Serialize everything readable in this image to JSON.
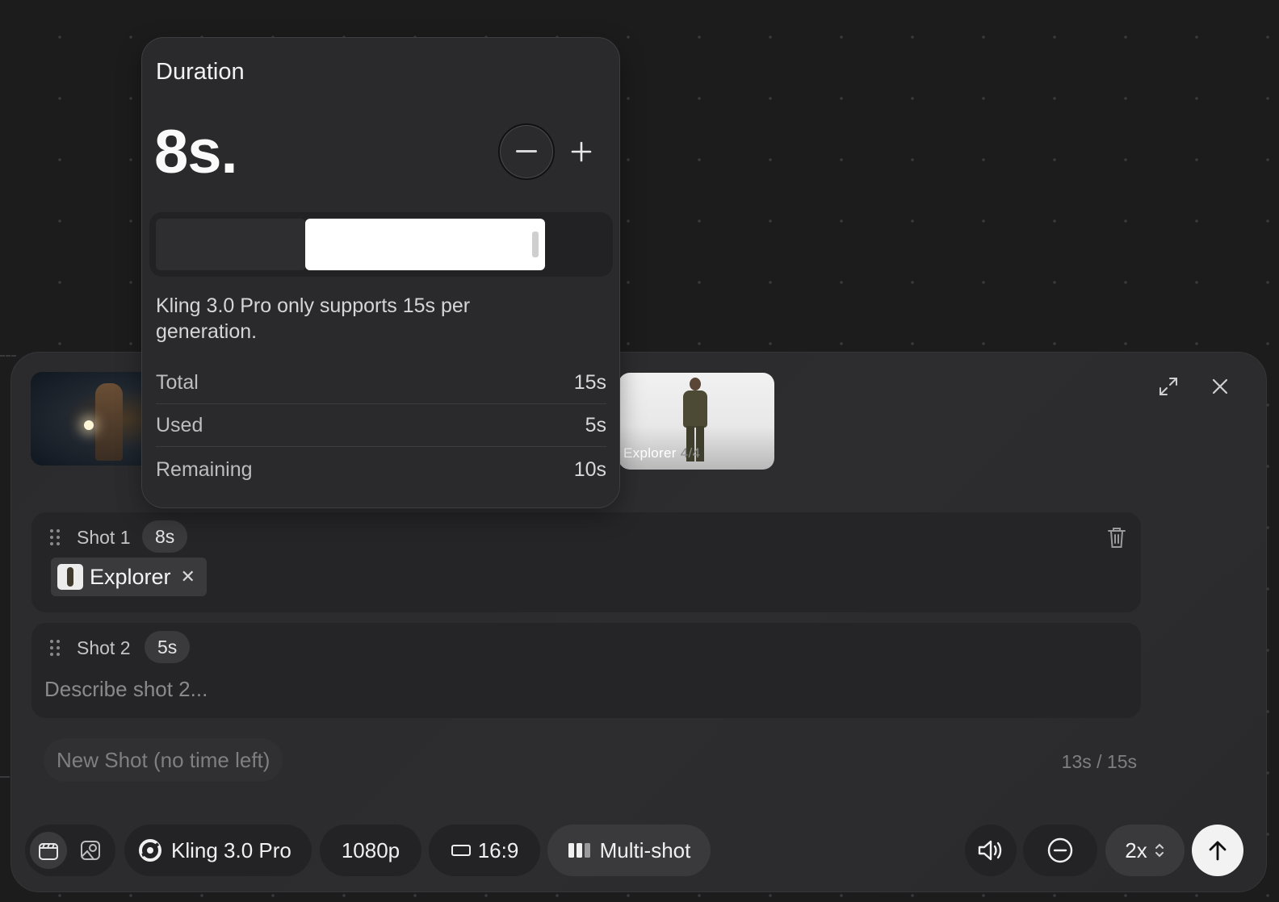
{
  "popover": {
    "title": "Duration",
    "value": "8s.",
    "track_selected_fraction": 0.533,
    "note": "Kling 3.0 Pro only supports 15s per generation.",
    "rows": [
      {
        "label": "Total",
        "value": "15s"
      },
      {
        "label": "Used",
        "value": "5s"
      },
      {
        "label": "Remaining",
        "value": "10s"
      }
    ]
  },
  "references": {
    "explorer_caption": "Explorer",
    "explorer_count": "4/4"
  },
  "shots": [
    {
      "label": "Shot 1",
      "duration": "8s",
      "chip_label": "Explorer",
      "chip_remove": "✕"
    },
    {
      "label": "Shot 2",
      "duration": "5s",
      "placeholder": "Describe shot 2..."
    }
  ],
  "footer": {
    "new_shot_label": "New Shot (no time left)",
    "time_counter": "13s / 15s"
  },
  "toolbar": {
    "model": "Kling 3.0 Pro",
    "resolution": "1080p",
    "aspect": "16:9",
    "mode": "Multi-shot",
    "speed": "2x"
  },
  "colors": {
    "background": "#1c1c1d",
    "panel": "#2c2c2e",
    "popover": "#2a2a2c",
    "accent_white": "#ffffff"
  }
}
